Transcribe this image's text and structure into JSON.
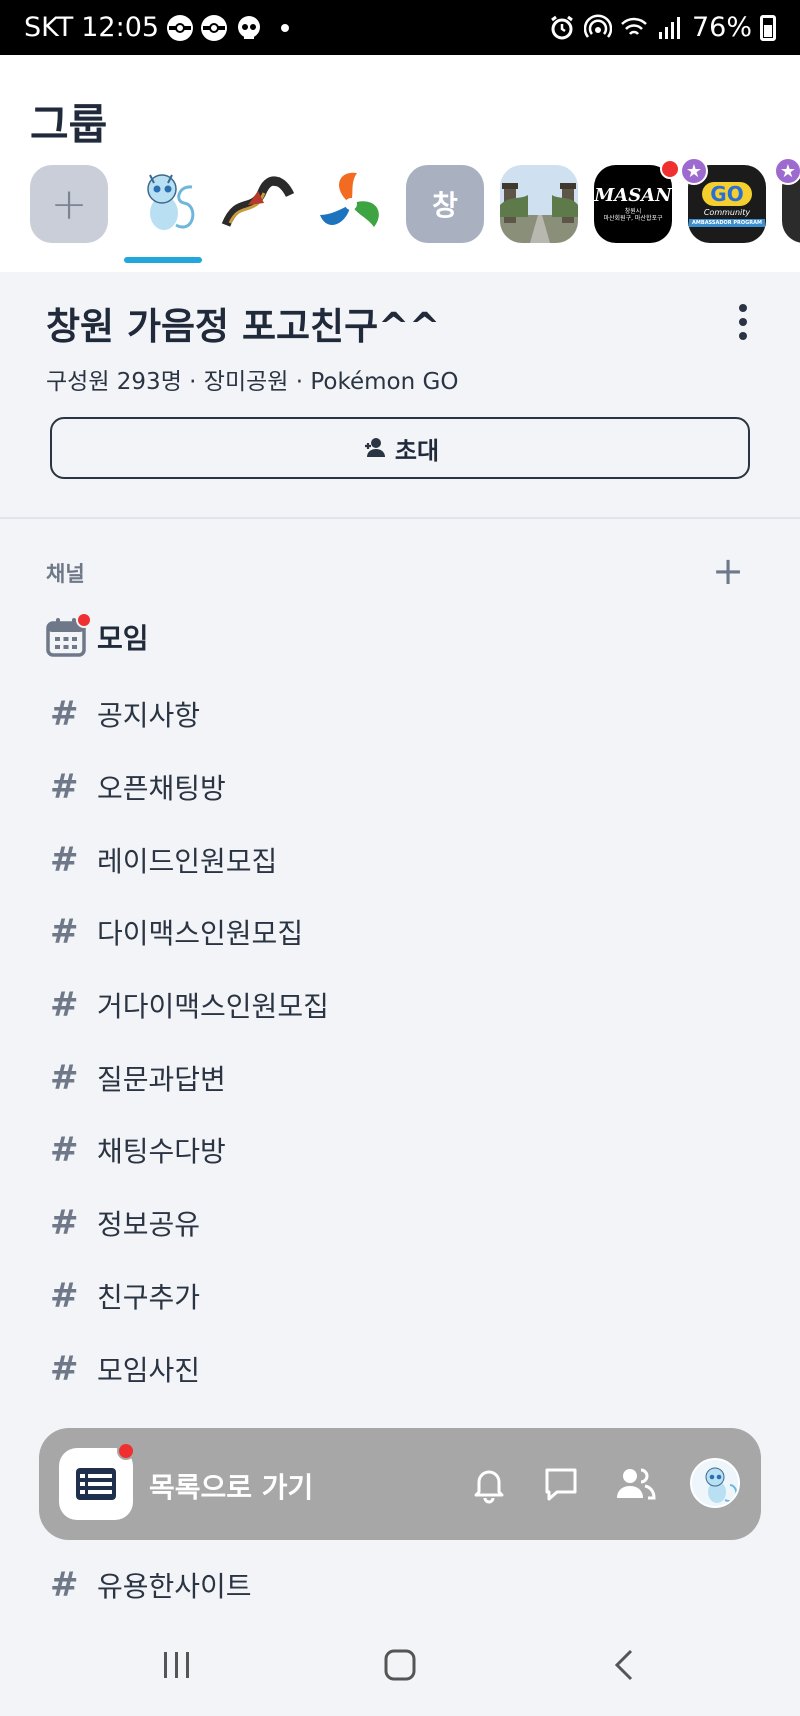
{
  "status_bar": {
    "carrier": "SKT",
    "time": "12:05",
    "battery": "76%",
    "icons": [
      "pokeball-icon",
      "pokeball-icon",
      "skull-icon",
      "dot-icon",
      "alarm-icon",
      "hotspot-icon",
      "wifi-icon",
      "signal-icon",
      "battery-icon"
    ]
  },
  "header": {
    "title": "그룹"
  },
  "servers": {
    "add_label": "+",
    "initial_label": "창",
    "items": [
      "add",
      "mew",
      "rayquaza",
      "community",
      "initial",
      "park",
      "masan",
      "ambassador",
      "partial"
    ],
    "masan_text": "MASAN",
    "masan_sub": "창원시\n마산회원구, 마산합포구",
    "ambassador_text": "AMBASSADOR PROGRAM",
    "ambassador_go": "GO",
    "ambassador_community": "Community"
  },
  "group": {
    "name": "창원 가음정 포고친구^^",
    "meta": "구성원 293명 · 장미공원 · Pokémon GO",
    "invite_label": "초대"
  },
  "channels": {
    "header": "채널",
    "meeting": "모임",
    "items": [
      "공지사항",
      "오픈채팅방",
      "레이드인원모집",
      "다이맥스인원모집",
      "거다이맥스인원모집",
      "질문과답변",
      "채팅수다방",
      "정보공유",
      "친구추가",
      "모임사진",
      "유용한사이트"
    ],
    "hash": "#"
  },
  "bottom_bar": {
    "label": "목록으로 가기"
  },
  "colors": {
    "accent": "#22a7dc",
    "notification": "#f03030",
    "text_primary": "#202a3a",
    "text_muted": "#6f7888",
    "background": "#f2f4f7"
  }
}
